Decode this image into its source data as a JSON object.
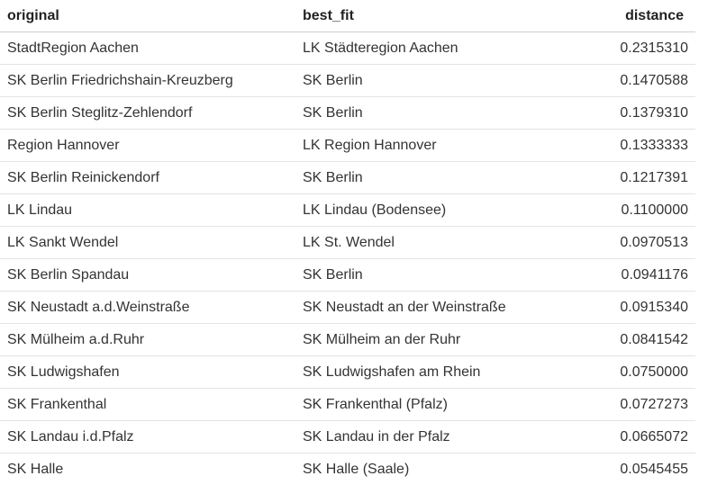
{
  "table": {
    "headers": {
      "original": "original",
      "best_fit": "best_fit",
      "distance": "distance"
    },
    "rows": [
      {
        "original": "StadtRegion Aachen",
        "best_fit": "LK Städteregion Aachen",
        "distance": "0.2315310"
      },
      {
        "original": "SK Berlin Friedrichshain-Kreuzberg",
        "best_fit": "SK Berlin",
        "distance": "0.1470588"
      },
      {
        "original": "SK Berlin Steglitz-Zehlendorf",
        "best_fit": "SK Berlin",
        "distance": "0.1379310"
      },
      {
        "original": "Region Hannover",
        "best_fit": "LK Region Hannover",
        "distance": "0.1333333"
      },
      {
        "original": "SK Berlin Reinickendorf",
        "best_fit": "SK Berlin",
        "distance": "0.1217391"
      },
      {
        "original": "LK Lindau",
        "best_fit": "LK Lindau (Bodensee)",
        "distance": "0.1100000"
      },
      {
        "original": "LK Sankt Wendel",
        "best_fit": "LK St. Wendel",
        "distance": "0.0970513"
      },
      {
        "original": "SK Berlin Spandau",
        "best_fit": "SK Berlin",
        "distance": "0.0941176"
      },
      {
        "original": "SK Neustadt a.d.Weinstraße",
        "best_fit": "SK Neustadt an der Weinstraße",
        "distance": "0.0915340"
      },
      {
        "original": "SK Mülheim a.d.Ruhr",
        "best_fit": "SK Mülheim an der Ruhr",
        "distance": "0.0841542"
      },
      {
        "original": "SK Ludwigshafen",
        "best_fit": "SK Ludwigshafen am Rhein",
        "distance": "0.0750000"
      },
      {
        "original": "SK Frankenthal",
        "best_fit": "SK Frankenthal (Pfalz)",
        "distance": "0.0727273"
      },
      {
        "original": "SK Landau i.d.Pfalz",
        "best_fit": "SK Landau in der Pfalz",
        "distance": "0.0665072"
      },
      {
        "original": "SK Halle",
        "best_fit": "SK Halle (Saale)",
        "distance": "0.0545455"
      }
    ]
  }
}
